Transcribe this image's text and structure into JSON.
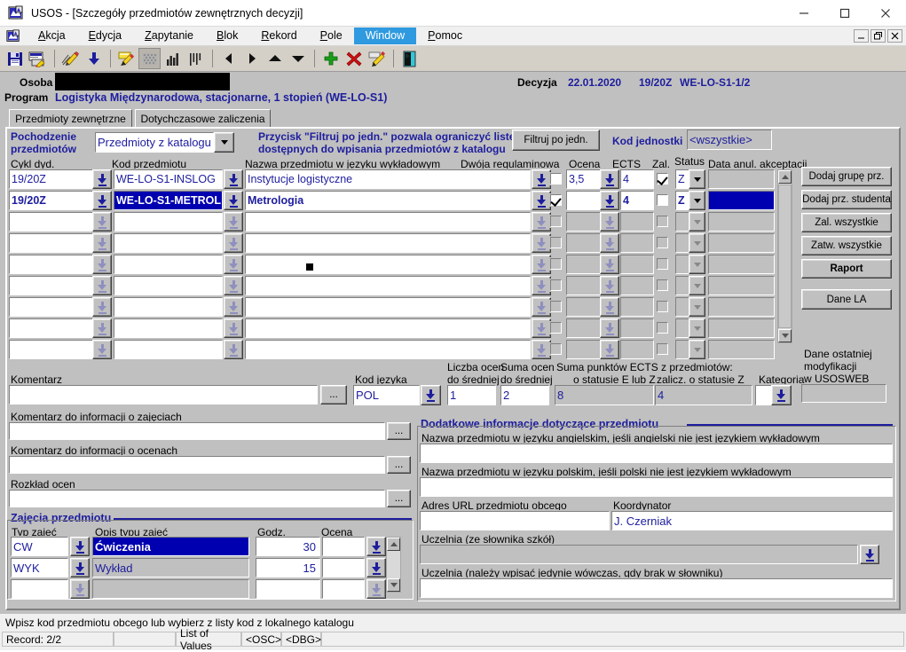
{
  "window": {
    "title": "USOS - [Szczegóły przedmiotów zewnętrznych decyzji]",
    "app_icon": "usos-app-icon",
    "minimize": "−",
    "maximize": "□",
    "close": "✕",
    "mdi_minimize": "_",
    "mdi_restore": "❐",
    "mdi_close": "✕"
  },
  "menu": {
    "icon": "usos-menu-icon",
    "items": [
      {
        "label": "Akcja",
        "active": false
      },
      {
        "label": "Edycja",
        "active": false
      },
      {
        "label": "Zapytanie",
        "active": false
      },
      {
        "label": "Blok",
        "active": false
      },
      {
        "label": "Rekord",
        "active": false
      },
      {
        "label": "Pole",
        "active": false
      },
      {
        "label": "Window",
        "active": true
      },
      {
        "label": "Pomoc",
        "active": false
      }
    ]
  },
  "toolbar": {
    "buttons": [
      {
        "name": "save-icon"
      },
      {
        "name": "print-icon"
      },
      {
        "name": "edit-pencil-icon"
      },
      {
        "name": "download-icon"
      },
      {
        "name": "enter-query-icon"
      },
      {
        "name": "cancel-query-icon"
      },
      {
        "name": "execute-query-icon"
      },
      {
        "name": "count-query-icon"
      },
      {
        "name": "previous-record-icon"
      },
      {
        "name": "next-record-icon"
      },
      {
        "name": "scroll-up-icon"
      },
      {
        "name": "scroll-down-icon"
      },
      {
        "name": "insert-record-icon"
      },
      {
        "name": "delete-record-icon"
      },
      {
        "name": "edit-record-icon"
      },
      {
        "name": "exit-icon"
      }
    ]
  },
  "header": {
    "osoba_label": "Osoba",
    "osoba_value": "",
    "program_label": "Program",
    "program_value": "Logistyka Międzynarodowa, stacjonarne, 1 stopień (WE-LO-S1)",
    "decyzja_label": "Decyzja",
    "decyzja_date": "22.01.2020",
    "decyzja_cycle": "19/20Z",
    "decyzja_code": "WE-LO-S1-1/2"
  },
  "tabs": [
    {
      "label": "Przedmioty zewnętrzne",
      "selected": true
    },
    {
      "label": "Dotychczasowe zaliczenia",
      "selected": false
    }
  ],
  "filter": {
    "origin_label_line1": "Pochodzenie",
    "origin_label_line2": "przedmiotów",
    "origin_value": "Przedmioty z katalogu",
    "hint_line1": "Przycisk \"Filtruj po jedn.\" pozwala  ograniczyć listę",
    "hint_line2": "dostępnych do wpisania przedmiotów z katalogu",
    "filter_button": "Filtruj po jedn.",
    "unit_label": "Kod jednostki",
    "unit_value": "<wszystkie>"
  },
  "grid": {
    "columns": [
      "Cykl dyd.",
      "Kod przedmiotu",
      "Nazwa przedmiotu w języku wykładowym",
      "Dwója regulaminowa",
      "Ocena",
      "ECTS",
      "Zal.",
      "Status",
      "Data anul. akceptacji"
    ],
    "rows": [
      {
        "cykl": "19/20Z",
        "kod": "WE-LO-S1-INSLOG",
        "nazwa": "Instytucje logistyczne",
        "dwoja": false,
        "ocena": "3,5",
        "ects": "4",
        "zal": true,
        "status": "Z",
        "data_anul": "",
        "selected": false
      },
      {
        "cykl": "19/20Z",
        "kod": "WE-LO-S1-METROL",
        "nazwa": "Metrologia",
        "dwoja": true,
        "ocena": "",
        "ects": "4",
        "zal": false,
        "status": "Z",
        "data_anul": "",
        "selected": true
      },
      {
        "cykl": "",
        "kod": "",
        "nazwa": "",
        "dwoja": false,
        "ocena": "",
        "ects": "",
        "zal": false,
        "status": "",
        "data_anul": "",
        "selected": false
      },
      {
        "cykl": "",
        "kod": "",
        "nazwa": "",
        "dwoja": false,
        "ocena": "",
        "ects": "",
        "zal": false,
        "status": "",
        "data_anul": "",
        "selected": false
      },
      {
        "cykl": "",
        "kod": "",
        "nazwa": "",
        "dwoja": false,
        "ocena": "",
        "ects": "",
        "zal": false,
        "status": "",
        "data_anul": "",
        "selected": false
      },
      {
        "cykl": "",
        "kod": "",
        "nazwa": "",
        "dwoja": false,
        "ocena": "",
        "ects": "",
        "zal": false,
        "status": "",
        "data_anul": "",
        "selected": false
      },
      {
        "cykl": "",
        "kod": "",
        "nazwa": "",
        "dwoja": false,
        "ocena": "",
        "ects": "",
        "zal": false,
        "status": "",
        "data_anul": "",
        "selected": false
      },
      {
        "cykl": "",
        "kod": "",
        "nazwa": "",
        "dwoja": false,
        "ocena": "",
        "ects": "",
        "zal": false,
        "status": "",
        "data_anul": "",
        "selected": false
      },
      {
        "cykl": "",
        "kod": "",
        "nazwa": "",
        "dwoja": false,
        "ocena": "",
        "ects": "",
        "zal": false,
        "status": "",
        "data_anul": "",
        "selected": false
      }
    ]
  },
  "side_buttons": [
    {
      "label": "Dodaj grupę prz.",
      "bold": false
    },
    {
      "label": "Dodaj prz. studenta",
      "bold": false
    },
    {
      "label": "Zal. wszystkie",
      "bold": false
    },
    {
      "label": "Zatw. wszystkie",
      "bold": false
    },
    {
      "label": "Raport",
      "bold": true
    },
    {
      "label": "Dane LA",
      "bold": false
    }
  ],
  "last_mod": {
    "line1": "Dane ostatniej",
    "line2": "modyfikacji",
    "line3": "w USOSWEB",
    "value": ""
  },
  "summary": {
    "komentarz_label": "Komentarz",
    "komentarz_value": "",
    "komentarz_btn": "...",
    "kod_jezyka_label": "Kod języka",
    "kod_jezyka_value": "POL",
    "liczba_ocen_l1": "Liczba ocen",
    "liczba_ocen_l2": "do średniej",
    "liczba_ocen_value": "1",
    "suma_ocen_l1": "Suma ocen",
    "suma_ocen_l2": "do średniej",
    "suma_ocen_value": "2",
    "ects_header": "Suma punktów ECTS z przedmiotów:",
    "ects_ez_label": "o statusie E lub Z",
    "ects_ez_value": "8",
    "ects_z_label": "zalicz. o statusie Z",
    "ects_z_value": "4",
    "kategoria_label": "Kategoria",
    "kategoria_value": ""
  },
  "comments": [
    {
      "label": "Komentarz do informacji o zajęciach",
      "value": "",
      "btn": "..."
    },
    {
      "label": "Komentarz do informacji o ocenach",
      "value": "",
      "btn": "..."
    },
    {
      "label": "Rozkład ocen",
      "value": "",
      "btn": "..."
    }
  ],
  "classes": {
    "group_title": "Zajęcia przedmiotu",
    "columns": [
      "Typ zajęć",
      "Opis typu zajęć",
      "Godz.",
      "Ocena"
    ],
    "rows": [
      {
        "typ": "CW",
        "opis": "Ćwiczenia",
        "godz": "30",
        "ocena": "",
        "selected": true
      },
      {
        "typ": "WYK",
        "opis": "Wykład",
        "godz": "15",
        "ocena": "",
        "selected": false
      },
      {
        "typ": "",
        "opis": "",
        "godz": "",
        "ocena": "",
        "selected": false
      }
    ]
  },
  "extra": {
    "group_title": "Dodatkowe informacje dotyczące przedmiotu",
    "name_en_label": "Nazwa przedmiotu w języku angielskim, jeśli angielski nie jest językiem wykładowym",
    "name_en_value": "",
    "name_pl_label": "Nazwa przedmiotu w języku polskim, jeśli polski nie jest językiem wykładowym",
    "name_pl_value": "",
    "url_label": "Adres URL przedmiotu obcego",
    "url_value": "",
    "coordinator_label": "Koordynator",
    "coordinator_value": "J. Czerniak",
    "school_dict_label": "Uczelnia (ze słownika szkół)",
    "school_dict_value": "",
    "school_free_label": "Uczelnia (należy wpisać jedynie wówczas, gdy brak w słowniku)",
    "school_free_value": ""
  },
  "statusbar": {
    "message": "Wpisz kod przedmiotu obcego lub wybierz z listy kod z lokalnego katalogu",
    "record": "Record: 2/2",
    "cell2": "",
    "lov": "List of Values",
    "osc": "<OSC>",
    "dbg": "<DBG>",
    "cell_last": ""
  },
  "colors": {
    "accent_blue": "#1d1d9e",
    "select_blue": "#0000b0",
    "menu_active": "#2f9ae0",
    "face": "#c0c0c0"
  }
}
